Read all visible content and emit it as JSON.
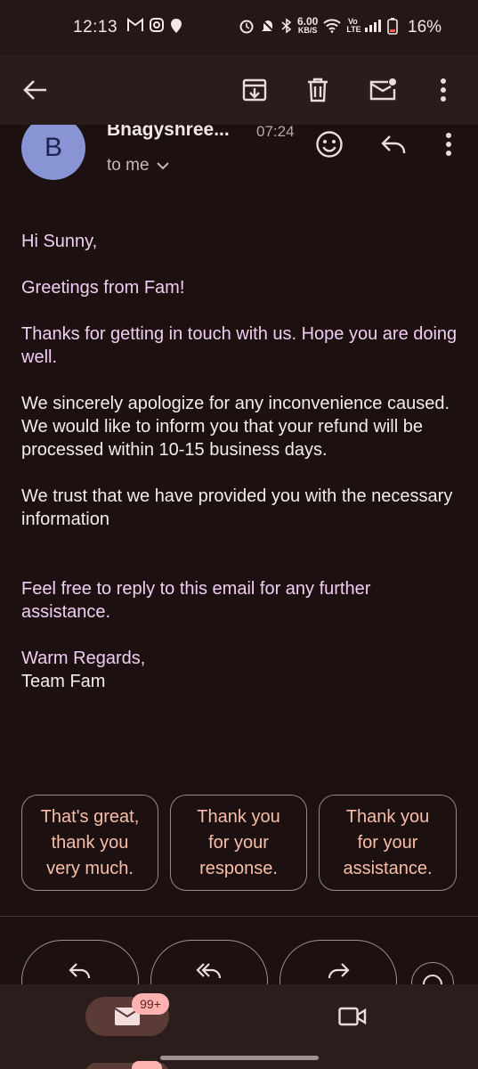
{
  "status_bar": {
    "time": "12:13",
    "network_speed_value": "6.00",
    "network_speed_unit": "KB/S",
    "volte_label": "Vo LTE",
    "battery": "16%"
  },
  "app_bar": {
    "icons": [
      "back-arrow-icon",
      "archive-icon",
      "delete-icon",
      "mark-unread-icon",
      "more-vert-icon"
    ]
  },
  "email": {
    "sender_initial": "B",
    "sender_name": "Bhagyshree...",
    "time": "07:24",
    "recipient": "to me",
    "paragraphs": [
      {
        "text": "Hi Sunny,",
        "tone": "pink"
      },
      {
        "text": "Greetings from Fam!",
        "tone": "pink"
      },
      {
        "text": "Thanks for getting in touch with us. Hope you are doing well.",
        "tone": "pink"
      },
      {
        "text": "We sincerely apologize for any inconvenience caused. We would like to inform you that your refund will be processed within 10-15 business days.",
        "tone": "white"
      },
      {
        "text": "We trust that we have provided you with the necessary information",
        "tone": "white"
      },
      {
        "text": "Feel free to reply to this email for any further assistance.",
        "tone": "pink"
      },
      {
        "text": "Warm Regards,",
        "tone": "pink"
      },
      {
        "text": "Team Fam",
        "tone": "white"
      }
    ]
  },
  "smart_replies": [
    {
      "line1": "That's great,",
      "line2": "thank you",
      "line3": "very much."
    },
    {
      "line1": "Thank you",
      "line2": "for your",
      "line3": "response."
    },
    {
      "line1": "Thank you",
      "line2": "for your",
      "line3": "assistance."
    }
  ],
  "bottom_nav": {
    "mail_badge": "99+"
  },
  "colors": {
    "background": "#1c1110",
    "accent_chip_text": "#f9bea8",
    "body_pink": "#f0cdf2",
    "avatar": "#8894d4",
    "badge": "#ffb3b0"
  }
}
